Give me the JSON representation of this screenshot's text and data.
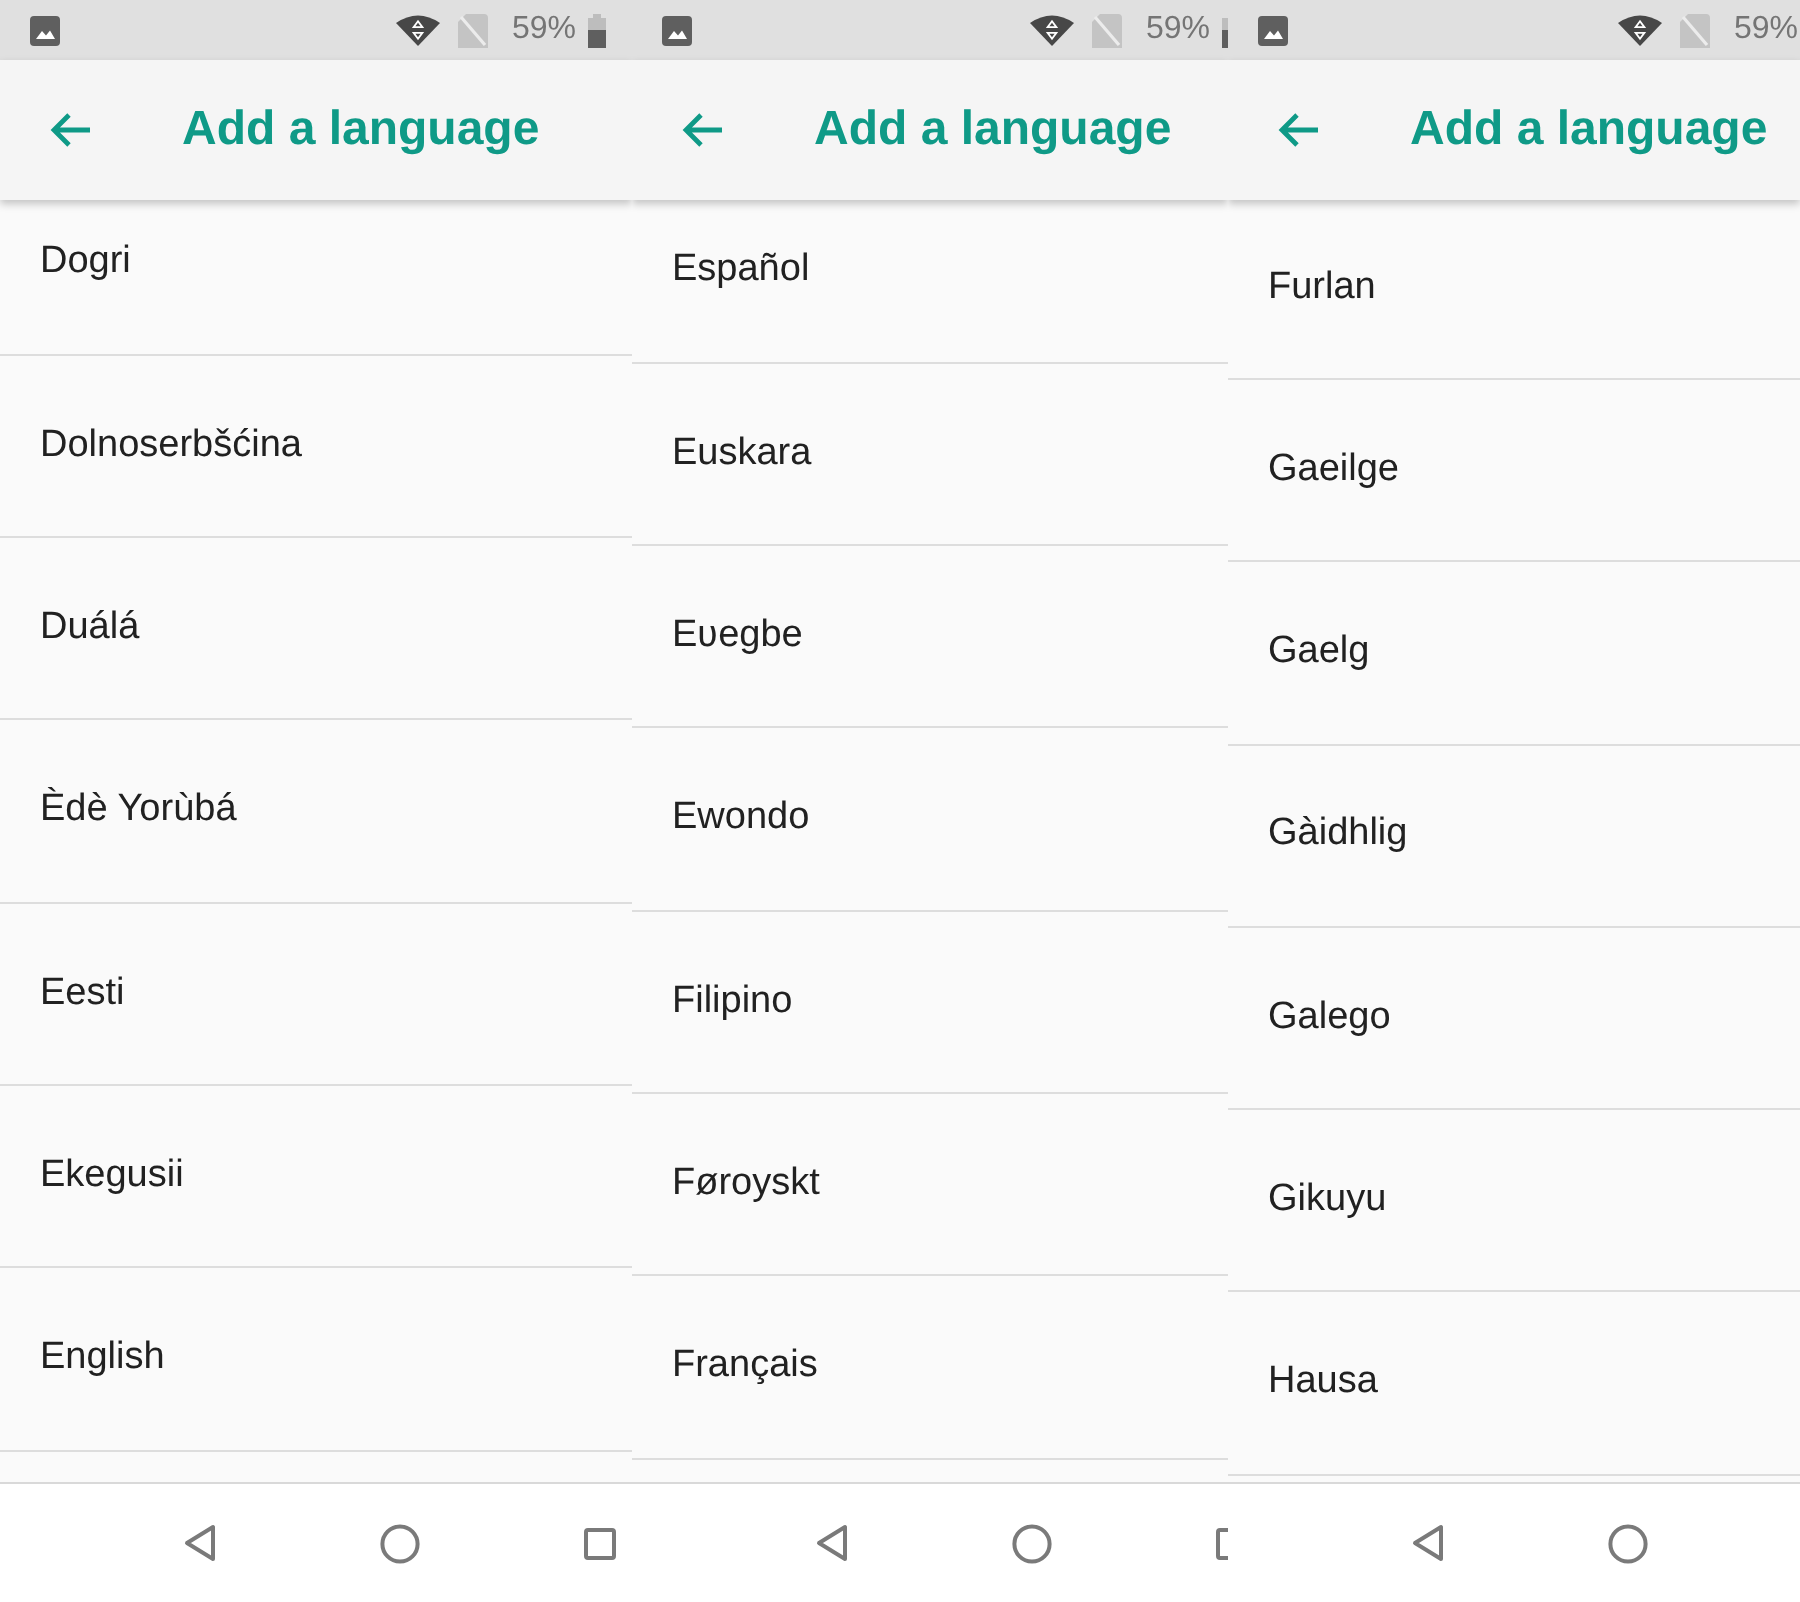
{
  "screens": [
    {
      "status_bar": {
        "battery_percent": "59%"
      },
      "app_bar": {
        "title": "Add a language"
      },
      "languages": [
        "Dogri",
        "Dolnoserbšćina",
        "Duálá",
        "Èdè Yorùbá",
        "Eesti",
        "Ekegusii",
        "English"
      ]
    },
    {
      "status_bar": {
        "battery_percent": "59%"
      },
      "app_bar": {
        "title": "Add a language"
      },
      "languages": [
        "Español",
        "Euskara",
        "Eʋegbe",
        "Ewondo",
        "Filipino",
        "Føroyskt",
        "Français"
      ]
    },
    {
      "status_bar": {
        "battery_percent": "59%"
      },
      "app_bar": {
        "title": "Add a language"
      },
      "languages": [
        "Furlan",
        "Gaeilge",
        "Gaelg",
        "Gàidhlig",
        "Galego",
        "Gikuyu",
        "Hausa"
      ]
    }
  ]
}
